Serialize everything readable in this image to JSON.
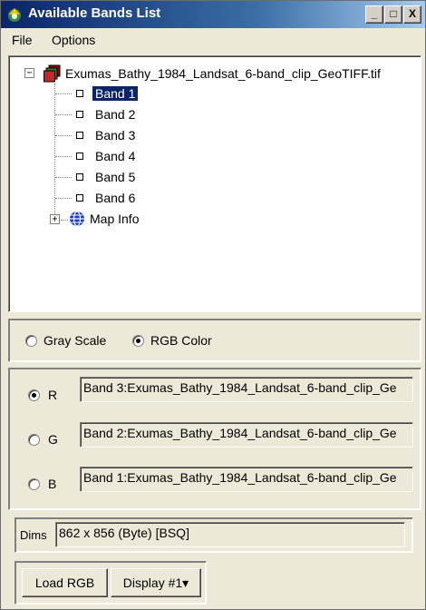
{
  "window": {
    "title": "Available Bands List",
    "controls": [
      "_",
      "□",
      "X"
    ]
  },
  "menu": [
    "File",
    "Options"
  ],
  "tree": {
    "root": {
      "label": "Exumas_Bathy_1984_Landsat_6-band_clip_GeoTIFF.tif",
      "expander": "−"
    },
    "bands": [
      "Band 1",
      "Band 2",
      "Band 3",
      "Band 4",
      "Band 5",
      "Band 6"
    ],
    "selected_band": "Band 1",
    "map_info": {
      "label": "Map Info",
      "expander": "+"
    }
  },
  "mode": {
    "gray_scale": "Gray Scale",
    "rgb_color": "RGB Color",
    "selected": "rgb_color"
  },
  "rgb": {
    "r": {
      "label": "R",
      "value": "Band 3:Exumas_Bathy_1984_Landsat_6-band_clip_Ge",
      "selected": true
    },
    "g": {
      "label": "G",
      "value": "Band 2:Exumas_Bathy_1984_Landsat_6-band_clip_Ge",
      "selected": false
    },
    "b": {
      "label": "B",
      "value": "Band 1:Exumas_Bathy_1984_Landsat_6-band_clip_Ge",
      "selected": false
    }
  },
  "dims": {
    "label": "Dims",
    "value": "862 x 856 (Byte) [BSQ]"
  },
  "buttons": {
    "load": "Load RGB",
    "display": "Display #1",
    "display_arrow": "▾"
  },
  "icons": {
    "app": "envi-app-icon",
    "file": "raster-file-icon",
    "map": "globe-icon"
  }
}
